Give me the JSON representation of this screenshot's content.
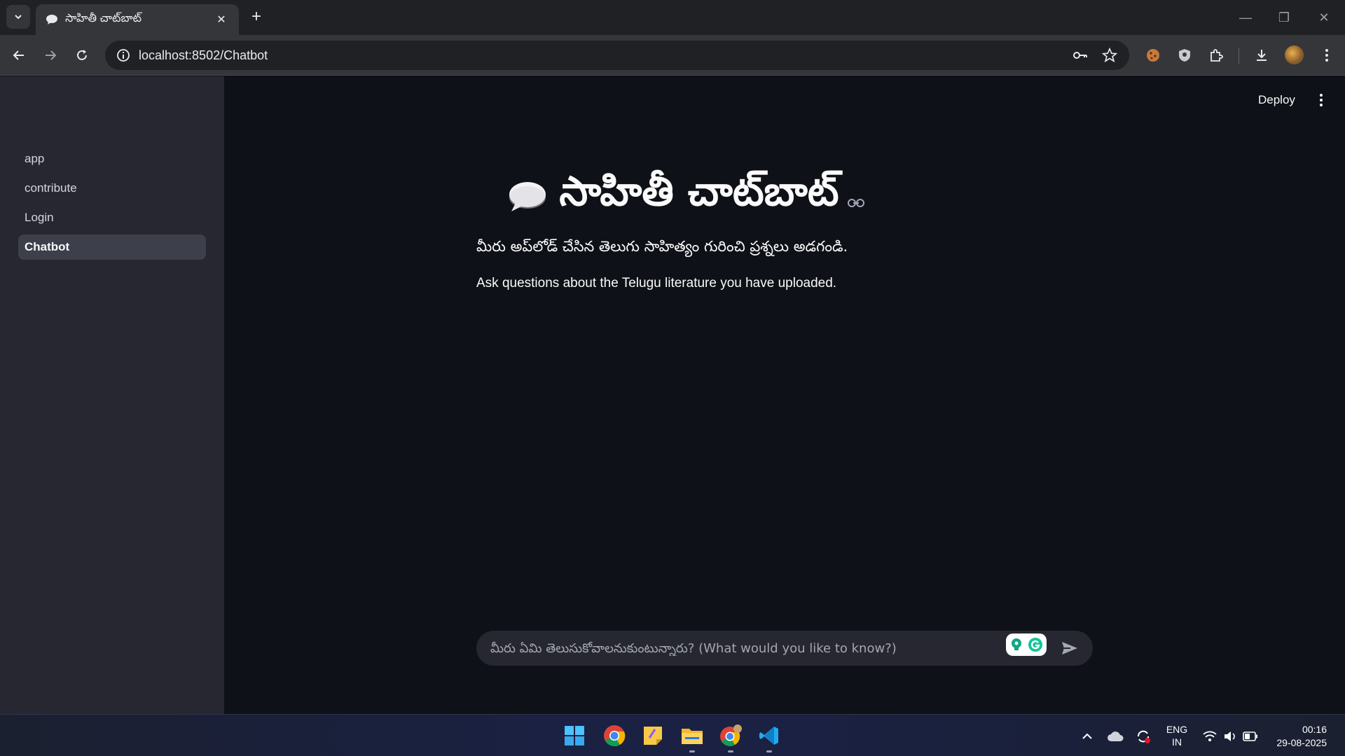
{
  "browser": {
    "tab_title": "సాహితీ చాట్‌బాట్",
    "url": "localhost:8502/Chatbot"
  },
  "app": {
    "header": {
      "deploy_label": "Deploy"
    },
    "sidebar": {
      "items": [
        {
          "label": "app",
          "active": false
        },
        {
          "label": "contribute",
          "active": false
        },
        {
          "label": "Login",
          "active": false
        },
        {
          "label": "Chatbot",
          "active": true
        }
      ]
    },
    "main": {
      "title": "సాహితీ చాట్‌బాట్",
      "subtitle_te": "మీరు అప్‌లోడ్ చేసిన తెలుగు సాహిత్యం గురించి ప్రశ్నలు అడగండి.",
      "subtitle_en": "Ask questions about the Telugu literature you have uploaded.",
      "chat_placeholder": "మీరు ఏమి తెలుసుకోవాలనుకుంటున్నారు? (What would you like to know?)"
    }
  },
  "taskbar": {
    "lang_line1": "ENG",
    "lang_line2": "IN",
    "time": "00:16",
    "date": "29-08-2025"
  },
  "colors": {
    "main_bg": "#0e1117",
    "sidebar_bg": "#262730",
    "active_item_bg": "#3d3f4b",
    "text": "#fafafa"
  }
}
